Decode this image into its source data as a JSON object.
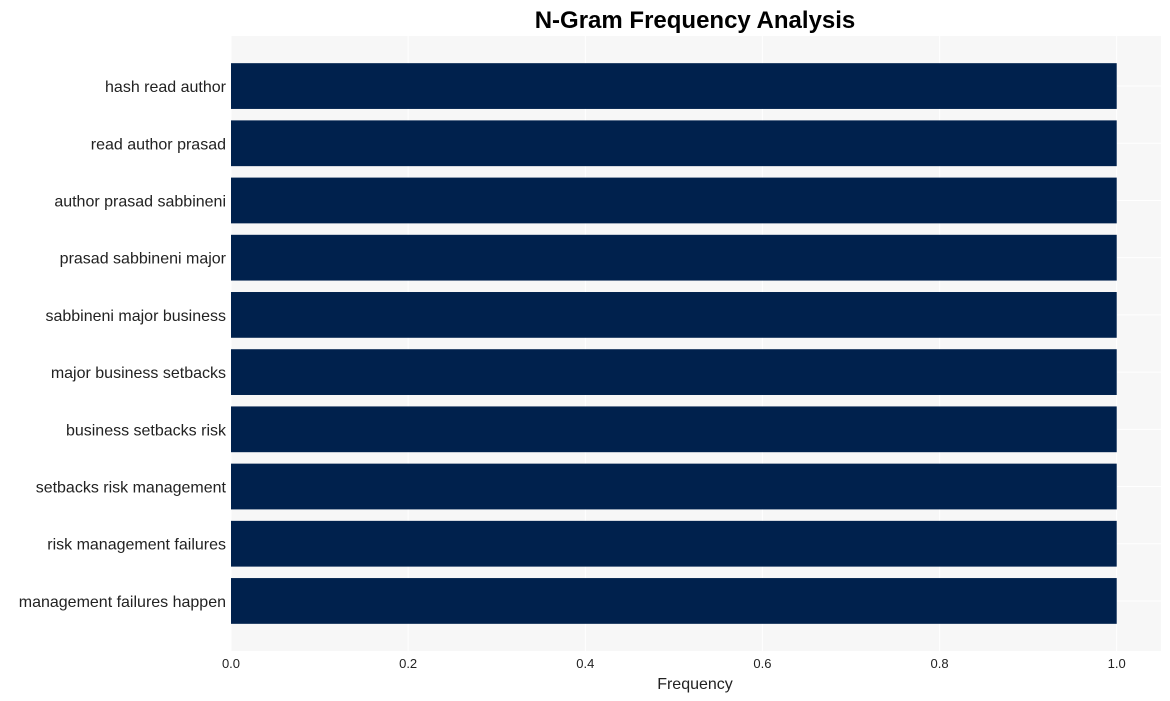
{
  "chart_data": {
    "type": "bar",
    "orientation": "horizontal",
    "title": "N-Gram Frequency Analysis",
    "xlabel": "Frequency",
    "ylabel": "",
    "categories": [
      "hash read author",
      "read author prasad",
      "author prasad sabbineni",
      "prasad sabbineni major",
      "sabbineni major business",
      "major business setbacks",
      "business setbacks risk",
      "setbacks risk management",
      "risk management failures",
      "management failures happen"
    ],
    "values": [
      1,
      1,
      1,
      1,
      1,
      1,
      1,
      1,
      1,
      1
    ],
    "xlim": [
      0,
      1.05
    ],
    "xticks": [
      0.0,
      0.2,
      0.4,
      0.6,
      0.8,
      1.0
    ],
    "xtick_labels": [
      "0.0",
      "0.2",
      "0.4",
      "0.6",
      "0.8",
      "1.0"
    ],
    "grid": true,
    "bar_color": "#00214d",
    "background_color": "#f7f7f7",
    "grid_color": "#ffffff"
  }
}
